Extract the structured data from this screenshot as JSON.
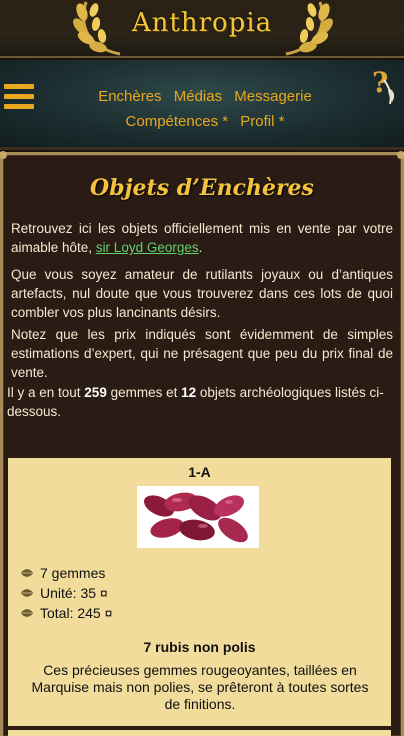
{
  "site": {
    "title": "Anthropia"
  },
  "nav": {
    "row1": [
      "Enchères",
      "Médias",
      "Messagerie"
    ],
    "row2": [
      "Compétences *",
      "Profil *"
    ]
  },
  "page": {
    "title": "Objets d’Enchères",
    "intro_before_link": "Retrouvez ici les objets officiellement mis en vente par votre aimable hôte, ",
    "host_link": "sir Loyd Georges",
    "intro_after_link": ".",
    "para2": "Que vous soyez amateur de rutilants joyaux ou d’antiques artefacts, nul doute que vous trouverez dans ces lots de quoi combler vos plus lancinants désirs.",
    "para3": "Notez que les prix indiqués sont évidemment de simples estimations d’expert, qui ne présagent que peu du prix final de vente.",
    "count_prefix": "Il y a en tout ",
    "gem_count": "259",
    "count_mid": " gemmes et ",
    "object_count": "12",
    "count_suffix": " objets archéologiques listés ci-dessous."
  },
  "item": {
    "code": "1-A",
    "specs": [
      "7 gemmes",
      "Unité: 35 ¤",
      "Total: 245 ¤"
    ],
    "name": "7 rubis non polis",
    "description": "Ces précieuses gemmes rougeoyantes, taillées en Marquise mais non polies, se prêteront à toutes sortes de finitions."
  },
  "colors": {
    "accent": "#e9a81e",
    "link": "#5fd36a",
    "card_bg": "#f2dc9b",
    "title_gold": "#f4c23c"
  },
  "icons": {
    "menu": "hamburger-icon",
    "help": "quill-question-icon",
    "bullet": "leaf-bullet-icon"
  }
}
